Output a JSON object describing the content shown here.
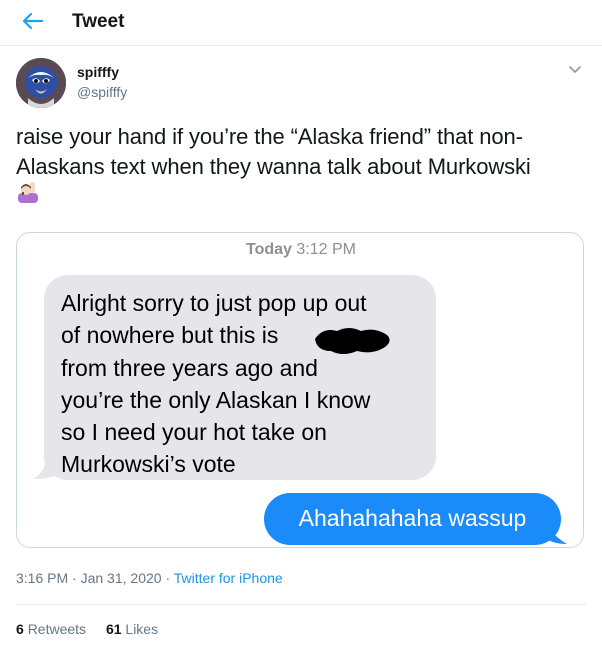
{
  "header": {
    "title": "Tweet",
    "back_icon": "arrow-left-icon"
  },
  "author": {
    "display_name": "spifffy",
    "handle": "@spifffy"
  },
  "tweet": {
    "text": "raise your hand if you’re the “Alaska friend” that non-Alaskans text when they wanna talk about Murkowski",
    "emoji_icon": "person-raising-hand-icon"
  },
  "media": {
    "timestamp_day": "Today",
    "timestamp_time": "3:12 PM",
    "incoming_message": {
      "line1": "Alright sorry to just pop up out",
      "line2": "of nowhere but this is",
      "line3": "from three years ago and",
      "line4": "you’re the only Alaskan I know",
      "line5": "so I need your hot take on",
      "line6": "Murkowski’s vote"
    },
    "outgoing_message": "Ahahahahaha wassup"
  },
  "meta": {
    "time": "3:16 PM",
    "separator": "·",
    "date": "Jan 31, 2020",
    "source": "Twitter for iPhone"
  },
  "stats": {
    "retweets_count": "6",
    "retweets_label": "Retweets",
    "likes_count": "61",
    "likes_label": "Likes"
  },
  "colors": {
    "accent": "#1b95e0",
    "imessage_blue": "#1b8bfa",
    "incoming_gray": "#e5e5ea"
  }
}
